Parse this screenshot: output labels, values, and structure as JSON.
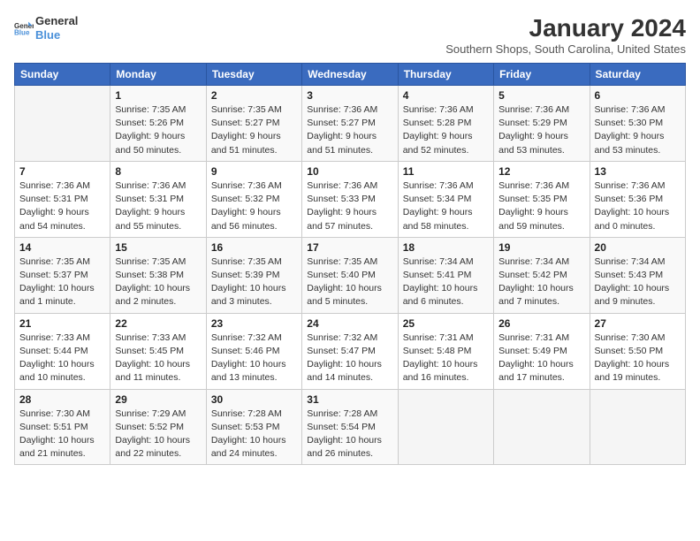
{
  "logo": {
    "line1": "General",
    "line2": "Blue"
  },
  "title": "January 2024",
  "subtitle": "Southern Shops, South Carolina, United States",
  "headers": [
    "Sunday",
    "Monday",
    "Tuesday",
    "Wednesday",
    "Thursday",
    "Friday",
    "Saturday"
  ],
  "weeks": [
    [
      {
        "day": "",
        "detail": ""
      },
      {
        "day": "1",
        "detail": "Sunrise: 7:35 AM\nSunset: 5:26 PM\nDaylight: 9 hours\nand 50 minutes."
      },
      {
        "day": "2",
        "detail": "Sunrise: 7:35 AM\nSunset: 5:27 PM\nDaylight: 9 hours\nand 51 minutes."
      },
      {
        "day": "3",
        "detail": "Sunrise: 7:36 AM\nSunset: 5:27 PM\nDaylight: 9 hours\nand 51 minutes."
      },
      {
        "day": "4",
        "detail": "Sunrise: 7:36 AM\nSunset: 5:28 PM\nDaylight: 9 hours\nand 52 minutes."
      },
      {
        "day": "5",
        "detail": "Sunrise: 7:36 AM\nSunset: 5:29 PM\nDaylight: 9 hours\nand 53 minutes."
      },
      {
        "day": "6",
        "detail": "Sunrise: 7:36 AM\nSunset: 5:30 PM\nDaylight: 9 hours\nand 53 minutes."
      }
    ],
    [
      {
        "day": "7",
        "detail": "Sunrise: 7:36 AM\nSunset: 5:31 PM\nDaylight: 9 hours\nand 54 minutes."
      },
      {
        "day": "8",
        "detail": "Sunrise: 7:36 AM\nSunset: 5:31 PM\nDaylight: 9 hours\nand 55 minutes."
      },
      {
        "day": "9",
        "detail": "Sunrise: 7:36 AM\nSunset: 5:32 PM\nDaylight: 9 hours\nand 56 minutes."
      },
      {
        "day": "10",
        "detail": "Sunrise: 7:36 AM\nSunset: 5:33 PM\nDaylight: 9 hours\nand 57 minutes."
      },
      {
        "day": "11",
        "detail": "Sunrise: 7:36 AM\nSunset: 5:34 PM\nDaylight: 9 hours\nand 58 minutes."
      },
      {
        "day": "12",
        "detail": "Sunrise: 7:36 AM\nSunset: 5:35 PM\nDaylight: 9 hours\nand 59 minutes."
      },
      {
        "day": "13",
        "detail": "Sunrise: 7:36 AM\nSunset: 5:36 PM\nDaylight: 10 hours\nand 0 minutes."
      }
    ],
    [
      {
        "day": "14",
        "detail": "Sunrise: 7:35 AM\nSunset: 5:37 PM\nDaylight: 10 hours\nand 1 minute."
      },
      {
        "day": "15",
        "detail": "Sunrise: 7:35 AM\nSunset: 5:38 PM\nDaylight: 10 hours\nand 2 minutes."
      },
      {
        "day": "16",
        "detail": "Sunrise: 7:35 AM\nSunset: 5:39 PM\nDaylight: 10 hours\nand 3 minutes."
      },
      {
        "day": "17",
        "detail": "Sunrise: 7:35 AM\nSunset: 5:40 PM\nDaylight: 10 hours\nand 5 minutes."
      },
      {
        "day": "18",
        "detail": "Sunrise: 7:34 AM\nSunset: 5:41 PM\nDaylight: 10 hours\nand 6 minutes."
      },
      {
        "day": "19",
        "detail": "Sunrise: 7:34 AM\nSunset: 5:42 PM\nDaylight: 10 hours\nand 7 minutes."
      },
      {
        "day": "20",
        "detail": "Sunrise: 7:34 AM\nSunset: 5:43 PM\nDaylight: 10 hours\nand 9 minutes."
      }
    ],
    [
      {
        "day": "21",
        "detail": "Sunrise: 7:33 AM\nSunset: 5:44 PM\nDaylight: 10 hours\nand 10 minutes."
      },
      {
        "day": "22",
        "detail": "Sunrise: 7:33 AM\nSunset: 5:45 PM\nDaylight: 10 hours\nand 11 minutes."
      },
      {
        "day": "23",
        "detail": "Sunrise: 7:32 AM\nSunset: 5:46 PM\nDaylight: 10 hours\nand 13 minutes."
      },
      {
        "day": "24",
        "detail": "Sunrise: 7:32 AM\nSunset: 5:47 PM\nDaylight: 10 hours\nand 14 minutes."
      },
      {
        "day": "25",
        "detail": "Sunrise: 7:31 AM\nSunset: 5:48 PM\nDaylight: 10 hours\nand 16 minutes."
      },
      {
        "day": "26",
        "detail": "Sunrise: 7:31 AM\nSunset: 5:49 PM\nDaylight: 10 hours\nand 17 minutes."
      },
      {
        "day": "27",
        "detail": "Sunrise: 7:30 AM\nSunset: 5:50 PM\nDaylight: 10 hours\nand 19 minutes."
      }
    ],
    [
      {
        "day": "28",
        "detail": "Sunrise: 7:30 AM\nSunset: 5:51 PM\nDaylight: 10 hours\nand 21 minutes."
      },
      {
        "day": "29",
        "detail": "Sunrise: 7:29 AM\nSunset: 5:52 PM\nDaylight: 10 hours\nand 22 minutes."
      },
      {
        "day": "30",
        "detail": "Sunrise: 7:28 AM\nSunset: 5:53 PM\nDaylight: 10 hours\nand 24 minutes."
      },
      {
        "day": "31",
        "detail": "Sunrise: 7:28 AM\nSunset: 5:54 PM\nDaylight: 10 hours\nand 26 minutes."
      },
      {
        "day": "",
        "detail": ""
      },
      {
        "day": "",
        "detail": ""
      },
      {
        "day": "",
        "detail": ""
      }
    ]
  ]
}
